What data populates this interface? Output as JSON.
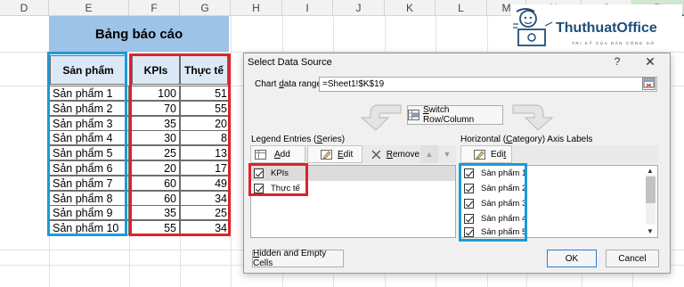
{
  "sheet": {
    "columns": [
      "D",
      "E",
      "F",
      "G",
      "H",
      "I",
      "J",
      "K",
      "L",
      "M",
      "N",
      "O",
      "P"
    ],
    "active_column": "P",
    "title": "Bảng báo cáo",
    "headers": [
      "Sản phẩm",
      "KPIs",
      "Thực tế"
    ],
    "rows": [
      {
        "product": "Sản phẩm 1",
        "kpi": "100",
        "actual": "51"
      },
      {
        "product": "Sản phẩm 2",
        "kpi": "70",
        "actual": "55"
      },
      {
        "product": "Sản phẩm 3",
        "kpi": "35",
        "actual": "20"
      },
      {
        "product": "Sản phẩm 4",
        "kpi": "30",
        "actual": "8"
      },
      {
        "product": "Sản phẩm 5",
        "kpi": "25",
        "actual": "13"
      },
      {
        "product": "Sản phẩm 6",
        "kpi": "20",
        "actual": "17"
      },
      {
        "product": "Sản phẩm 7",
        "kpi": "60",
        "actual": "49"
      },
      {
        "product": "Sản phẩm 8",
        "kpi": "60",
        "actual": "34"
      },
      {
        "product": "Sản phẩm 9",
        "kpi": "35",
        "actual": "25"
      },
      {
        "product": "Sản phẩm 10",
        "kpi": "55",
        "actual": "34"
      }
    ],
    "header_fill": "#9dc3e6",
    "annotation_blue": "#1e9ad6",
    "annotation_red": "#e0212c"
  },
  "dialog": {
    "title": "Select Data Source",
    "help": "?",
    "close": "✕",
    "range_label": {
      "pre": "Chart ",
      "key": "d",
      "post": "ata range:"
    },
    "range_value": "=Sheet1!$K$19",
    "switch_button": {
      "key": "S",
      "rest": "witch Row/Column"
    },
    "legend": {
      "label": {
        "pre": "Legend Entries (",
        "key": "S",
        "post": "eries)"
      },
      "add": {
        "key": "A",
        "rest": "dd"
      },
      "edit": {
        "key": "E",
        "rest": "dit"
      },
      "remove": {
        "key": "R",
        "rest": "emove"
      },
      "items": [
        {
          "label": "KPIs",
          "checked": true
        },
        {
          "label": "Thực tế",
          "checked": true
        }
      ]
    },
    "axis": {
      "label": {
        "pre": "Horizontal (",
        "key": "C",
        "post": "ategory) Axis Labels"
      },
      "edit": {
        "pre": "Edi",
        "key": "t",
        "post": ""
      },
      "items": [
        {
          "label": "Sản phẩm 1",
          "checked": true
        },
        {
          "label": "Sản phẩm 2",
          "checked": true
        },
        {
          "label": "Sản phẩm 3",
          "checked": true
        },
        {
          "label": "Sản phẩm 4",
          "checked": true
        },
        {
          "label": "Sản phẩm 5",
          "checked": true
        }
      ]
    },
    "hidden_cells_button": {
      "key": "H",
      "rest": "idden and Empty Cells"
    },
    "ok": "OK",
    "cancel": "Cancel"
  },
  "logo": {
    "name": "ThuthuatOffice",
    "tagline": "TRI KỶ CỦA DÂN CÔNG SỞ",
    "color": "#1f4e79"
  }
}
